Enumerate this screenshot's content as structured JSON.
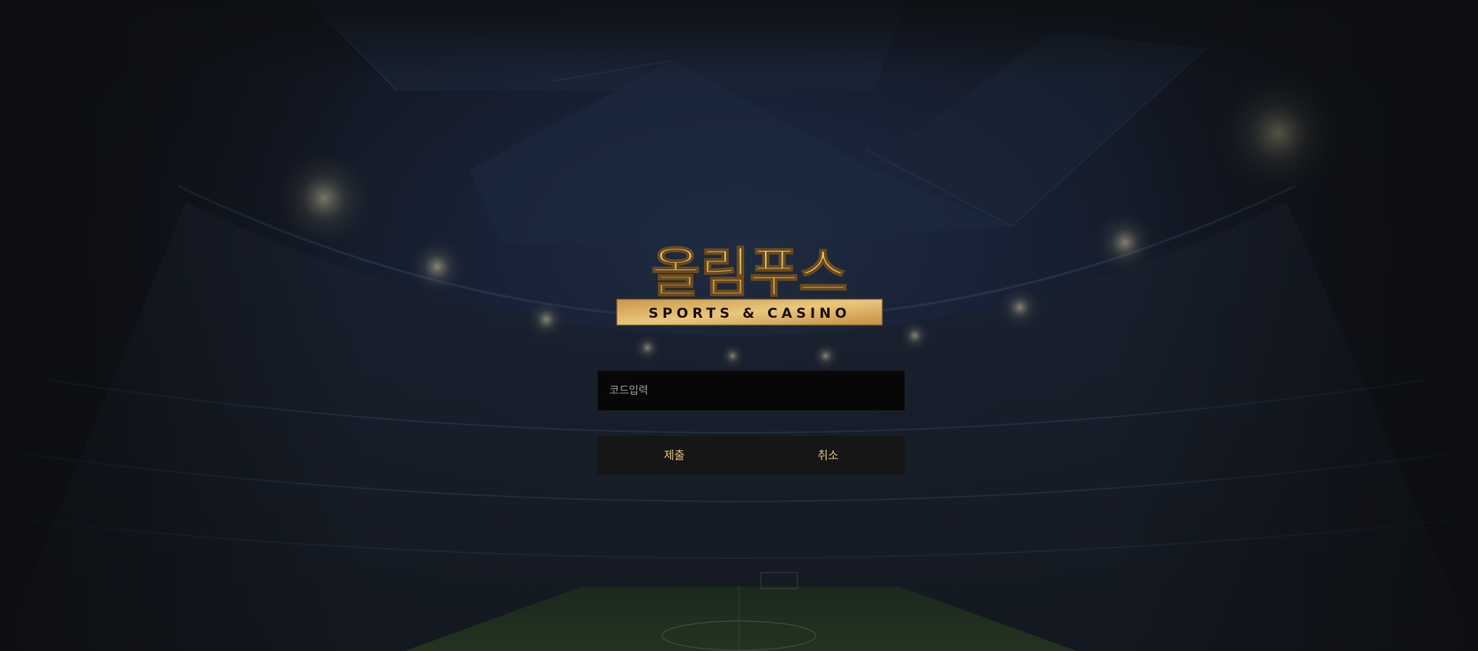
{
  "logo": {
    "title": "올림푸스",
    "subtitle": "SPORTS & CASINO"
  },
  "code_form": {
    "code_placeholder": "코드입력",
    "code_value": "",
    "submit_label": "제출",
    "cancel_label": "취소"
  },
  "colors": {
    "accent_gold": "#e2c27a",
    "input_bg": "#070707",
    "button_bar_bg": "#161616"
  }
}
